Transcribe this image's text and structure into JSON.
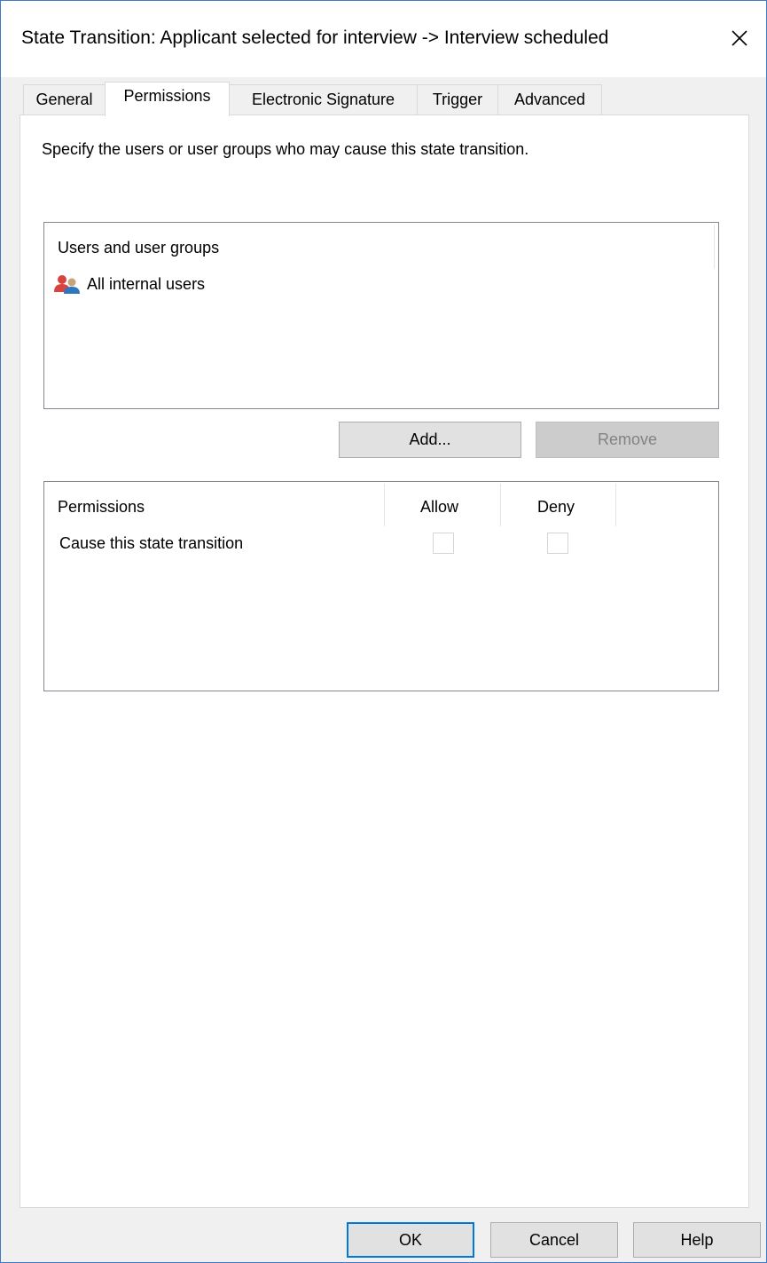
{
  "window": {
    "title": "State Transition: Applicant selected for interview -> Interview scheduled",
    "close_icon": "close-icon"
  },
  "tabs": [
    {
      "label": "General",
      "active": false
    },
    {
      "label": "Permissions",
      "active": true
    },
    {
      "label": "Electronic Signature",
      "active": false
    },
    {
      "label": "Trigger",
      "active": false
    },
    {
      "label": "Advanced",
      "active": false
    }
  ],
  "permissions_tab": {
    "instructions": "Specify the users or user groups who may cause this state transition.",
    "users_list": {
      "header": "Users and user groups",
      "items": [
        {
          "label": "All internal users",
          "icon": "user-group-icon"
        }
      ]
    },
    "add_label": "Add...",
    "remove_label": "Remove",
    "table": {
      "columns": [
        "Permissions",
        "Allow",
        "Deny"
      ],
      "rows": [
        {
          "label": "Cause this state transition",
          "allow": false,
          "deny": false
        }
      ]
    }
  },
  "footer": {
    "ok_label": "OK",
    "cancel_label": "Cancel",
    "help_label": "Help"
  },
  "colors": {
    "window_border": "#3d7ac7",
    "default_button_border": "#0078d7",
    "user_icon_red": "#d9433f",
    "user_icon_blue": "#2f76c0"
  }
}
